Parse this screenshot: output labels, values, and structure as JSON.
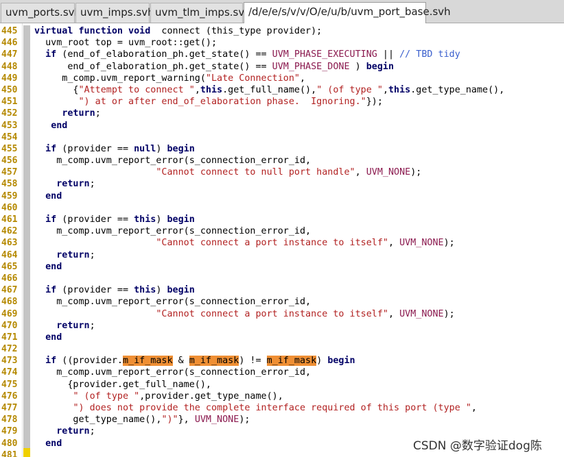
{
  "tabs": [
    {
      "label": "uvm_ports.svh",
      "active": false
    },
    {
      "label": "uvm_imps.svh",
      "active": false
    },
    {
      "label": "uvm_tlm_imps.svh",
      "active": false
    },
    {
      "label": "/d/e/e/s/v/v/O/e/u/b/uvm_port_base.svh",
      "active": true
    }
  ],
  "colors": {
    "line_numbers": "#b58900",
    "keyword": "#000066",
    "string": "#b22222",
    "constant": "#8b1a4f",
    "comment": "#3a5fcd",
    "highlight": "#ef8f34"
  },
  "editor": {
    "lines": [
      {
        "n": "445",
        "t": [
          [
            "kw",
            "virtual function void"
          ],
          [
            "",
            "  connect (this_type provider);"
          ]
        ]
      },
      {
        "n": "446",
        "t": [
          [
            "",
            "  uvm_root top = uvm_root::get();"
          ]
        ]
      },
      {
        "n": "447",
        "t": [
          [
            "",
            "  "
          ],
          [
            "kw",
            "if"
          ],
          [
            "",
            " (end_of_elaboration_ph.get_state() == "
          ],
          [
            "const",
            "UVM_PHASE_EXECUTING"
          ],
          [
            "",
            " || "
          ],
          [
            "cmt",
            "// TBD tidy"
          ]
        ]
      },
      {
        "n": "448",
        "t": [
          [
            "",
            "      end_of_elaboration_ph.get_state() == "
          ],
          [
            "const",
            "UVM_PHASE_DONE"
          ],
          [
            "",
            " ) "
          ],
          [
            "kw",
            "begin"
          ]
        ]
      },
      {
        "n": "449",
        "t": [
          [
            "",
            "     m_comp.uvm_report_warning("
          ],
          [
            "str",
            "\"Late Connection\""
          ],
          [
            "",
            ","
          ]
        ]
      },
      {
        "n": "450",
        "t": [
          [
            "",
            "       {"
          ],
          [
            "str",
            "\"Attempt to connect \""
          ],
          [
            "",
            ","
          ],
          [
            "kw",
            "this"
          ],
          [
            "",
            ".get_full_name(),"
          ],
          [
            "str",
            "\" (of type \""
          ],
          [
            "",
            ","
          ],
          [
            "kw",
            "this"
          ],
          [
            "",
            ".get_type_name(),"
          ]
        ]
      },
      {
        "n": "451",
        "t": [
          [
            "",
            "        "
          ],
          [
            "str",
            "\") at or after end_of_elaboration phase.  Ignoring.\""
          ],
          [
            "",
            "});"
          ]
        ]
      },
      {
        "n": "452",
        "t": [
          [
            "",
            "     "
          ],
          [
            "kw",
            "return"
          ],
          [
            "",
            ";"
          ]
        ]
      },
      {
        "n": "453",
        "t": [
          [
            "",
            "   "
          ],
          [
            "kw",
            "end"
          ]
        ]
      },
      {
        "n": "454",
        "t": [
          [
            "",
            ""
          ]
        ]
      },
      {
        "n": "455",
        "t": [
          [
            "",
            "  "
          ],
          [
            "kw",
            "if"
          ],
          [
            "",
            " (provider == "
          ],
          [
            "kw",
            "null"
          ],
          [
            "",
            ") "
          ],
          [
            "kw",
            "begin"
          ]
        ]
      },
      {
        "n": "456",
        "t": [
          [
            "",
            "    m_comp.uvm_report_error(s_connection_error_id,"
          ]
        ]
      },
      {
        "n": "457",
        "t": [
          [
            "",
            "                      "
          ],
          [
            "str",
            "\"Cannot connect to null port handle\""
          ],
          [
            "",
            ", "
          ],
          [
            "const",
            "UVM_NONE"
          ],
          [
            "",
            ");"
          ]
        ]
      },
      {
        "n": "458",
        "t": [
          [
            "",
            "    "
          ],
          [
            "kw",
            "return"
          ],
          [
            "",
            ";"
          ]
        ]
      },
      {
        "n": "459",
        "t": [
          [
            "",
            "  "
          ],
          [
            "kw",
            "end"
          ]
        ]
      },
      {
        "n": "460",
        "t": [
          [
            "",
            ""
          ]
        ]
      },
      {
        "n": "461",
        "t": [
          [
            "",
            "  "
          ],
          [
            "kw",
            "if"
          ],
          [
            "",
            " (provider == "
          ],
          [
            "kw",
            "this"
          ],
          [
            "",
            ") "
          ],
          [
            "kw",
            "begin"
          ]
        ]
      },
      {
        "n": "462",
        "t": [
          [
            "",
            "    m_comp.uvm_report_error(s_connection_error_id,"
          ]
        ]
      },
      {
        "n": "463",
        "t": [
          [
            "",
            "                      "
          ],
          [
            "str",
            "\"Cannot connect a port instance to itself\""
          ],
          [
            "",
            ", "
          ],
          [
            "const",
            "UVM_NONE"
          ],
          [
            "",
            ");"
          ]
        ]
      },
      {
        "n": "464",
        "t": [
          [
            "",
            "    "
          ],
          [
            "kw",
            "return"
          ],
          [
            "",
            ";"
          ]
        ]
      },
      {
        "n": "465",
        "t": [
          [
            "",
            "  "
          ],
          [
            "kw",
            "end"
          ]
        ]
      },
      {
        "n": "466",
        "t": [
          [
            "",
            ""
          ]
        ]
      },
      {
        "n": "467",
        "t": [
          [
            "",
            "  "
          ],
          [
            "kw",
            "if"
          ],
          [
            "",
            " (provider == "
          ],
          [
            "kw",
            "this"
          ],
          [
            "",
            ") "
          ],
          [
            "kw",
            "begin"
          ]
        ]
      },
      {
        "n": "468",
        "t": [
          [
            "",
            "    m_comp.uvm_report_error(s_connection_error_id,"
          ]
        ]
      },
      {
        "n": "469",
        "t": [
          [
            "",
            "                      "
          ],
          [
            "str",
            "\"Cannot connect a port instance to itself\""
          ],
          [
            "",
            ", "
          ],
          [
            "const",
            "UVM_NONE"
          ],
          [
            "",
            ");"
          ]
        ]
      },
      {
        "n": "470",
        "t": [
          [
            "",
            "    "
          ],
          [
            "kw",
            "return"
          ],
          [
            "",
            ";"
          ]
        ]
      },
      {
        "n": "471",
        "t": [
          [
            "",
            "  "
          ],
          [
            "kw",
            "end"
          ]
        ]
      },
      {
        "n": "472",
        "t": [
          [
            "",
            ""
          ]
        ]
      },
      {
        "n": "473",
        "t": [
          [
            "",
            "  "
          ],
          [
            "kw",
            "if"
          ],
          [
            "",
            " ((provider."
          ],
          [
            "hl",
            "m_if_mask"
          ],
          [
            "",
            " & "
          ],
          [
            "hl",
            "m_if_mask"
          ],
          [
            "",
            ") != "
          ],
          [
            "hl",
            "m_if_mask"
          ],
          [
            "",
            ") "
          ],
          [
            "kw",
            "begin"
          ]
        ]
      },
      {
        "n": "474",
        "t": [
          [
            "",
            "    m_comp.uvm_report_error(s_connection_error_id,"
          ]
        ]
      },
      {
        "n": "475",
        "t": [
          [
            "",
            "      {provider.get_full_name(),"
          ]
        ]
      },
      {
        "n": "476",
        "t": [
          [
            "",
            "       "
          ],
          [
            "str",
            "\" (of type \""
          ],
          [
            "",
            ",provider.get_type_name(),"
          ]
        ]
      },
      {
        "n": "477",
        "t": [
          [
            "",
            "       "
          ],
          [
            "str",
            "\") does not provide the complete interface required of this port (type \""
          ],
          [
            "",
            ","
          ]
        ]
      },
      {
        "n": "478",
        "t": [
          [
            "",
            "       get_type_name(),"
          ],
          [
            "str",
            "\")\""
          ],
          [
            "",
            "}, "
          ],
          [
            "const",
            "UVM_NONE"
          ],
          [
            "",
            ");"
          ]
        ]
      },
      {
        "n": "479",
        "t": [
          [
            "",
            "    "
          ],
          [
            "kw",
            "return"
          ],
          [
            "",
            ";"
          ]
        ]
      },
      {
        "n": "480",
        "t": [
          [
            "",
            "  "
          ],
          [
            "kw",
            "end"
          ]
        ]
      },
      {
        "n": "481",
        "t": [
          [
            "",
            ""
          ]
        ]
      }
    ]
  },
  "watermark": "CSDN @数字验证dog陈"
}
